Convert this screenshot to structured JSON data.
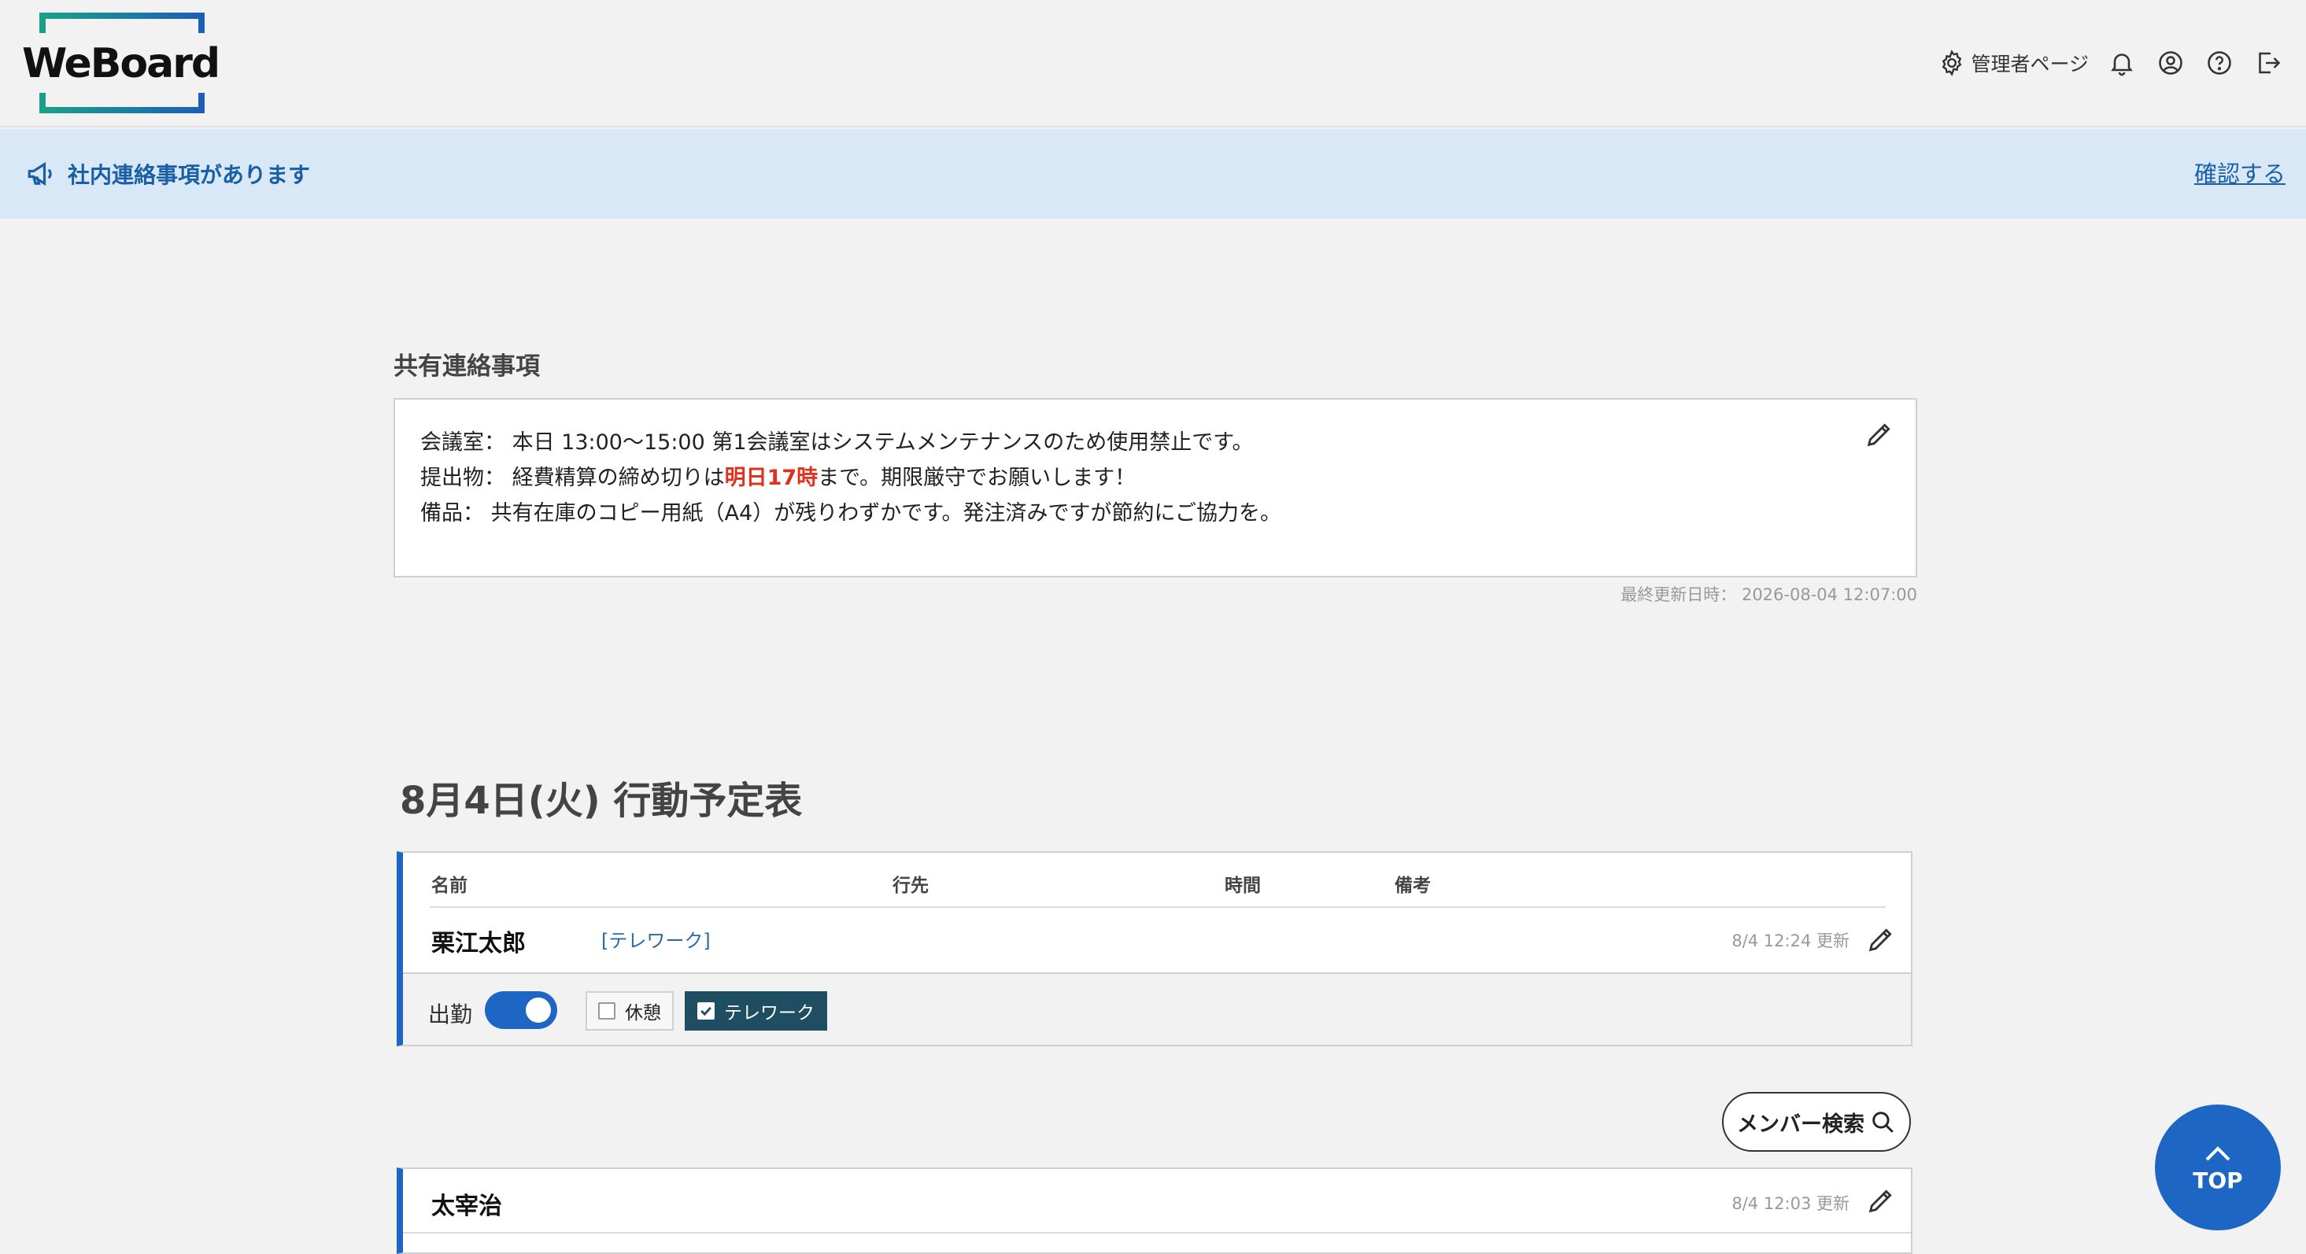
{
  "header": {
    "logo_text": "WeBoard",
    "admin_label": "管理者ページ"
  },
  "notice": {
    "text": "社内連絡事項があります",
    "link": "確認する"
  },
  "shared": {
    "title": "共有連絡事項",
    "lines": [
      {
        "prefix": "会議室： 本日 13:00〜15:00 第1会議室はシステムメンテナンスのため使用禁止です。",
        "highlight": "",
        "suffix": ""
      },
      {
        "prefix": "提出物： 経費精算の締め切りは",
        "highlight": "明日17時",
        "suffix": "まで。期限厳守でお願いします！"
      },
      {
        "prefix": "備品： 共有在庫のコピー用紙（A4）が残りわずかです。発注済みですが節約にご協力を。",
        "highlight": "",
        "suffix": ""
      }
    ],
    "updated": "最終更新日時： 2026-08-04 12:07:00"
  },
  "schedule": {
    "title": "8月4日(火) 行動予定表",
    "columns": [
      "名前",
      "行先",
      "時間",
      "備考"
    ],
    "member": {
      "name": "栗江太郎",
      "destination": "[テレワーク]",
      "updated": "8/4 12:24 更新",
      "attend_label": "出勤",
      "attend_on": true,
      "options": [
        {
          "label": "休憩",
          "checked": false
        },
        {
          "label": "テレワーク",
          "checked": true
        }
      ]
    },
    "search_label": "メンバー検索",
    "member2": {
      "name": "太宰治",
      "updated": "8/4 12:03 更新"
    }
  },
  "top_button": "TOP",
  "colors": {
    "accent": "#1d66c4",
    "notice_bg": "#d9e8f7",
    "highlight": "#e0301e",
    "checked_bg": "#1f4e63"
  }
}
